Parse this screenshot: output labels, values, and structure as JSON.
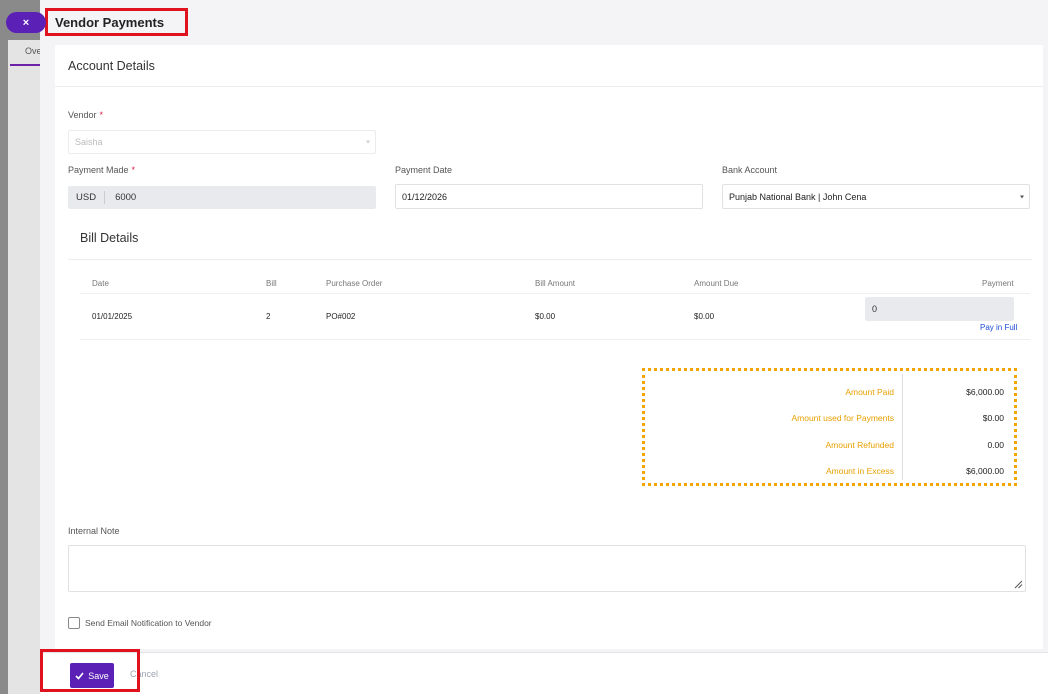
{
  "background": {
    "close_label": "×",
    "tab_fragment": "Ove"
  },
  "drawer": {
    "title": "Vendor Payments"
  },
  "account_details": {
    "heading": "Account Details",
    "vendor_label": "Vendor",
    "required_mark": "*",
    "vendor_value": "Saisha",
    "payment_made_label": "Payment Made",
    "currency": "USD",
    "payment_made_value": "6000",
    "payment_date_label": "Payment Date",
    "payment_date_value": "01/12/2026",
    "bank_account_label": "Bank Account",
    "bank_account_value": "Punjab National Bank | John Cena"
  },
  "bill_details": {
    "heading": "Bill Details",
    "columns": [
      "Date",
      "Bill",
      "Purchase Order",
      "Bill Amount",
      "Amount Due",
      "Payment"
    ],
    "rows": [
      {
        "date": "01/01/2025",
        "bill": "2",
        "purchase_order": "PO#002",
        "bill_amount": "$0.00",
        "amount_due": "$0.00",
        "payment": "0",
        "pay_in_full": "Pay in Full"
      }
    ]
  },
  "summary": {
    "items": [
      {
        "label": "Amount Paid",
        "value": "$6,000.00"
      },
      {
        "label": "Amount used for Payments",
        "value": "$0.00"
      },
      {
        "label": "Amount Refunded",
        "value": "0.00"
      },
      {
        "label": "Amount in Excess",
        "value": "$6,000.00"
      }
    ]
  },
  "internal_note": {
    "label": "Internal Note",
    "value": ""
  },
  "notification": {
    "label": "Send Email Notification to Vendor",
    "checked": false
  },
  "footer": {
    "save_label": "Save",
    "cancel_label": "Cancel"
  },
  "colors": {
    "primary": "#5b21b6",
    "highlight": "#e0121e",
    "summary_accent": "#f0a500",
    "link": "#1d4ed8"
  }
}
